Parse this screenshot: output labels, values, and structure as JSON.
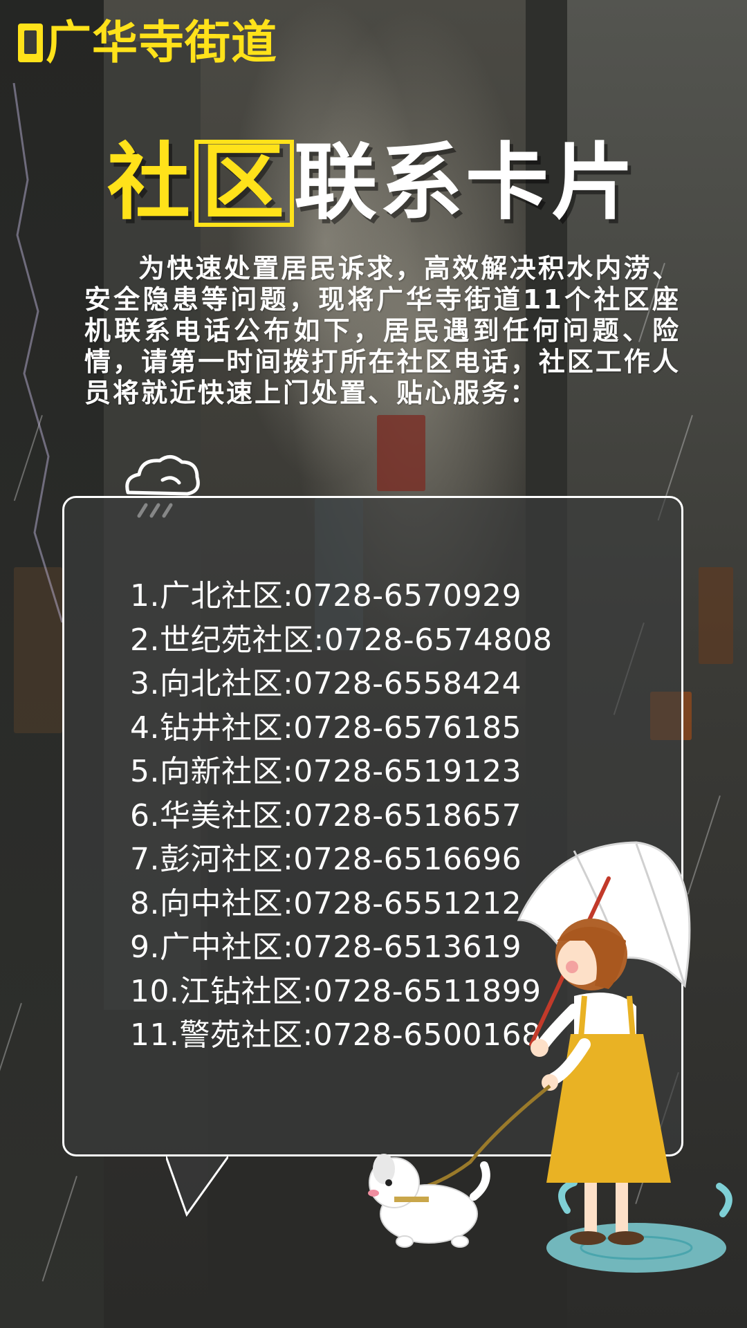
{
  "brand": {
    "name": "广华寺街道"
  },
  "title": {
    "part_yellow_1": "社",
    "part_yellow_2": "区",
    "part_white": "联系卡片"
  },
  "intro": "为快速处置居民诉求，高效解决积水内涝、安全隐患等问题，现将广华寺街道11个社区座机联系电话公布如下，居民遇到任何问题、险情，请第一时间拨打所在社区电话，社区工作人员将就近快速上门处置、贴心服务：",
  "contacts": [
    {
      "text": "1.广北社区:0728-6570929"
    },
    {
      "text": "2.世纪苑社区:0728-6574808"
    },
    {
      "text": "3.向北社区:0728-6558424"
    },
    {
      "text": "4.钻井社区:0728-6576185"
    },
    {
      "text": "5.向新社区:0728-6519123"
    },
    {
      "text": "6.华美社区:0728-6518657"
    },
    {
      "text": "7.彭河社区:0728-6516696"
    },
    {
      "text": "8.向中社区:0728-6551212"
    },
    {
      "text": "9.广中社区:0728-6513619"
    },
    {
      "text": "10.江钻社区:0728-6511899"
    },
    {
      "text": "11.警苑社区:0728-6500168"
    }
  ],
  "colors": {
    "accent": "#ffe21a",
    "text": "#ffffff"
  },
  "icons": [
    "rain-cloud-icon",
    "girl-umbrella-illustration",
    "dog-illustration"
  ]
}
